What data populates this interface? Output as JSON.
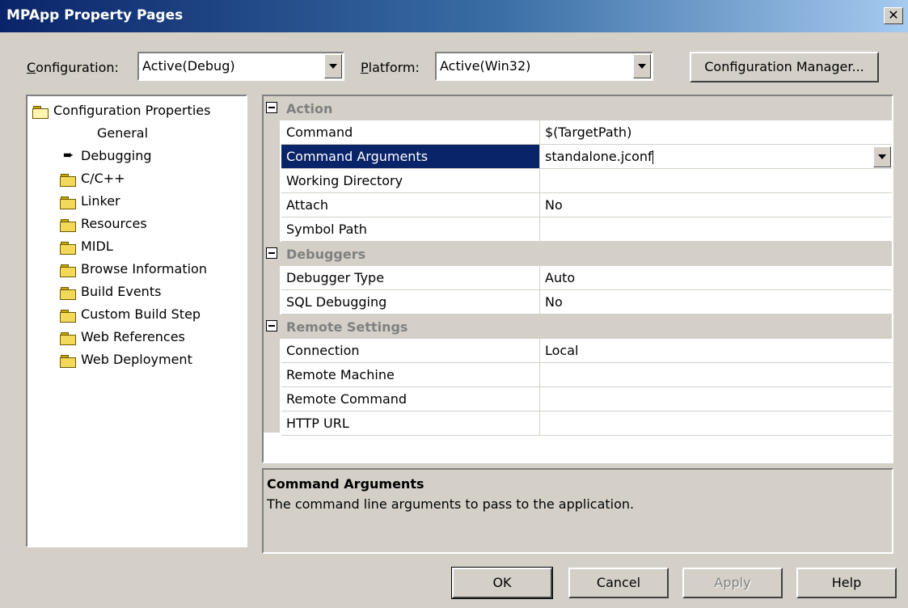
{
  "window": {
    "title": "MPApp Property Pages",
    "close_label": "✕"
  },
  "toolbar": {
    "configuration_label": "Configuration:",
    "configuration_value": "Active(Debug)",
    "platform_label": "Platform:",
    "platform_value": "Active(Win32)",
    "config_manager_label": "Configuration Manager..."
  },
  "tree": {
    "root": {
      "label": "Configuration Properties",
      "icon": "open-folder-icon"
    },
    "items": [
      {
        "label": "General",
        "icon": "none"
      },
      {
        "label": "Debugging",
        "icon": "arrow-icon"
      },
      {
        "label": "C/C++",
        "icon": "folder-icon"
      },
      {
        "label": "Linker",
        "icon": "folder-icon"
      },
      {
        "label": "Resources",
        "icon": "folder-icon"
      },
      {
        "label": "MIDL",
        "icon": "folder-icon"
      },
      {
        "label": "Browse Information",
        "icon": "folder-icon"
      },
      {
        "label": "Build Events",
        "icon": "folder-icon"
      },
      {
        "label": "Custom Build Step",
        "icon": "folder-icon"
      },
      {
        "label": "Web References",
        "icon": "folder-icon"
      },
      {
        "label": "Web Deployment",
        "icon": "folder-icon"
      }
    ]
  },
  "grid": {
    "categories": [
      {
        "label": "Action",
        "rows": [
          {
            "name": "Command",
            "value": "$(TargetPath)"
          },
          {
            "name": "Command Arguments",
            "value": "standalone.jconf"
          },
          {
            "name": "Working Directory",
            "value": ""
          },
          {
            "name": "Attach",
            "value": "No"
          },
          {
            "name": "Symbol Path",
            "value": ""
          }
        ]
      },
      {
        "label": "Debuggers",
        "rows": [
          {
            "name": "Debugger Type",
            "value": "Auto"
          },
          {
            "name": "SQL Debugging",
            "value": "No"
          }
        ]
      },
      {
        "label": "Remote Settings",
        "rows": [
          {
            "name": "Connection",
            "value": "Local"
          },
          {
            "name": "Remote Machine",
            "value": ""
          },
          {
            "name": "Remote Command",
            "value": ""
          },
          {
            "name": "HTTP URL",
            "value": ""
          }
        ]
      }
    ]
  },
  "description": {
    "title": "Command Arguments",
    "text": "The command line arguments to pass to the application."
  },
  "buttons": {
    "ok": "OK",
    "cancel": "Cancel",
    "apply": "Apply",
    "help": "Help"
  },
  "colors": {
    "selection": "#0a246a",
    "dialog_bg": "#d4d0c8",
    "title_start": "#0a246a",
    "title_end": "#a6caf0"
  }
}
